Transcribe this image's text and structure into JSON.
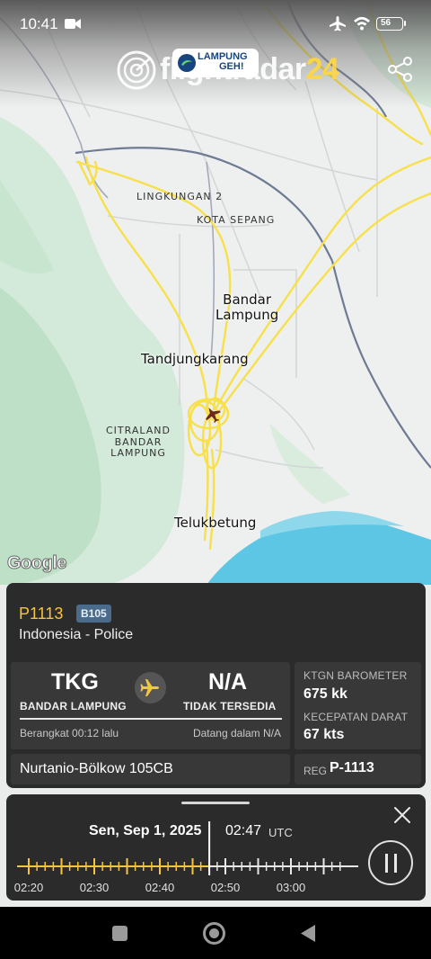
{
  "status_bar": {
    "time": "10:41",
    "battery": "56"
  },
  "brand": {
    "name_part1": "flightradar",
    "name_part2": "24",
    "badge_line1": "LAMPUNG",
    "badge_line2": "GEH!"
  },
  "map": {
    "attribution": "Google",
    "labels": {
      "lingkungan": "LINGKUNGAN 2",
      "kota_sepang": "KOTA SEPANG",
      "bandar_lampung": "Bandar\nLampung",
      "tandjungkarang": "Tandjungkarang",
      "citraland": "CITRALAND\nBANDAR\nLAMPUNG",
      "telukbetung": "Telukbetung"
    }
  },
  "flight": {
    "callsign": "P1113",
    "model_code": "B105",
    "operator": "Indonesia - Police",
    "origin_code": "TKG",
    "origin_name": "BANDAR LAMPUNG",
    "dest_code": "N/A",
    "dest_name": "TIDAK TERSEDIA",
    "departed": "Berangkat 00:12 lalu",
    "arrival": "Datang dalam N/A",
    "altitude_label": "KTGN BAROMETER",
    "altitude_value": "675 kk",
    "speed_label": "KECEPATAN DARAT",
    "speed_value": "67 kts",
    "aircraft": "Nurtanio-Bölkow 105CB",
    "reg_label": "REG",
    "reg_value": "P-1113"
  },
  "playback": {
    "date": "Sen, Sep 1, 2025",
    "time": "02:47",
    "tz": "UTC",
    "ticks": [
      "02:20",
      "02:30",
      "02:40",
      "02:50",
      "03:00"
    ],
    "progress": 0.58
  },
  "colors": {
    "accent": "#f5c542",
    "panel": "#2b2b2b",
    "box": "#383838",
    "water": "#5cc6e4",
    "track": "#f7e04a"
  }
}
